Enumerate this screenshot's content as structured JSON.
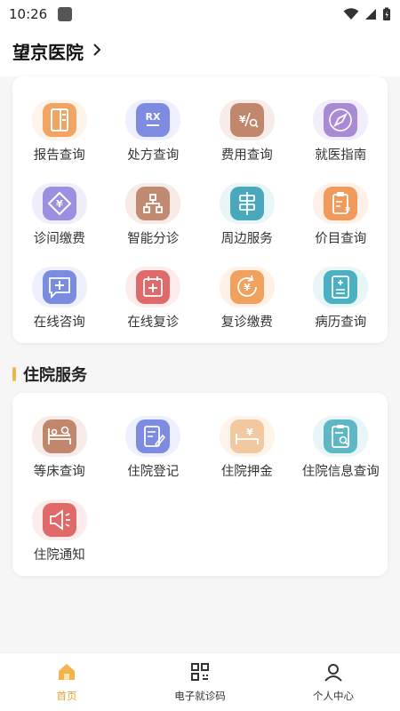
{
  "status_bar": {
    "time": "10:26"
  },
  "header": {
    "title": "望京医院"
  },
  "services": [
    {
      "label": "报告查询",
      "icon": "report-icon",
      "halo": "#fff4ea",
      "tile": "#f2a463"
    },
    {
      "label": "处方查询",
      "icon": "prescription-icon",
      "halo": "#eef1fd",
      "tile": "#7d8be0"
    },
    {
      "label": "费用查询",
      "icon": "fee-icon",
      "halo": "#f7ece8",
      "tile": "#c0876d"
    },
    {
      "label": "就医指南",
      "icon": "compass-icon",
      "halo": "#f3eefb",
      "tile": "#a98bd5"
    },
    {
      "label": "诊间缴费",
      "icon": "payment-icon",
      "halo": "#f0eefb",
      "tile": "#9a8fe0"
    },
    {
      "label": "智能分诊",
      "icon": "triage-icon",
      "halo": "#f6ebe6",
      "tile": "#c08a73"
    },
    {
      "label": "周边服务",
      "icon": "signpost-icon",
      "halo": "#e9f6f8",
      "tile": "#4aa8bd"
    },
    {
      "label": "价目查询",
      "icon": "price-list-icon",
      "halo": "#fff1e8",
      "tile": "#f09a5c"
    },
    {
      "label": "在线咨询",
      "icon": "chat-plus-icon",
      "halo": "#eef1fd",
      "tile": "#7a8ce0"
    },
    {
      "label": "在线复诊",
      "icon": "revisit-icon",
      "halo": "#fdecec",
      "tile": "#e06a6a"
    },
    {
      "label": "复诊缴费",
      "icon": "revisit-payment-icon",
      "halo": "#fff1e6",
      "tile": "#f0a15e"
    },
    {
      "label": "病历查询",
      "icon": "medical-record-icon",
      "halo": "#e8f6f8",
      "tile": "#4ab0c2"
    }
  ],
  "inpatient": {
    "title": "住院服务",
    "items": [
      {
        "label": "等床查询",
        "icon": "bed-wait-icon",
        "halo": "#f7ece8",
        "tile": "#c0876d"
      },
      {
        "label": "住院登记",
        "icon": "register-icon",
        "halo": "#eef1fd",
        "tile": "#7d8be0"
      },
      {
        "label": "住院押金",
        "icon": "deposit-icon",
        "halo": "#fff4ea",
        "tile": "#f2c8a0"
      },
      {
        "label": "住院信息查询",
        "icon": "inpatient-info-icon",
        "halo": "#e9f6f8",
        "tile": "#5fb7c6"
      },
      {
        "label": "住院通知",
        "icon": "notice-icon",
        "halo": "#fdecec",
        "tile": "#e06a6a"
      }
    ]
  },
  "tabbar": [
    {
      "label": "首页",
      "icon": "home-icon",
      "active": true
    },
    {
      "label": "电子就诊码",
      "icon": "qr-code-icon",
      "active": false
    },
    {
      "label": "个人中心",
      "icon": "user-icon",
      "active": false
    }
  ],
  "colors": {
    "accent": "#e8a33a"
  }
}
